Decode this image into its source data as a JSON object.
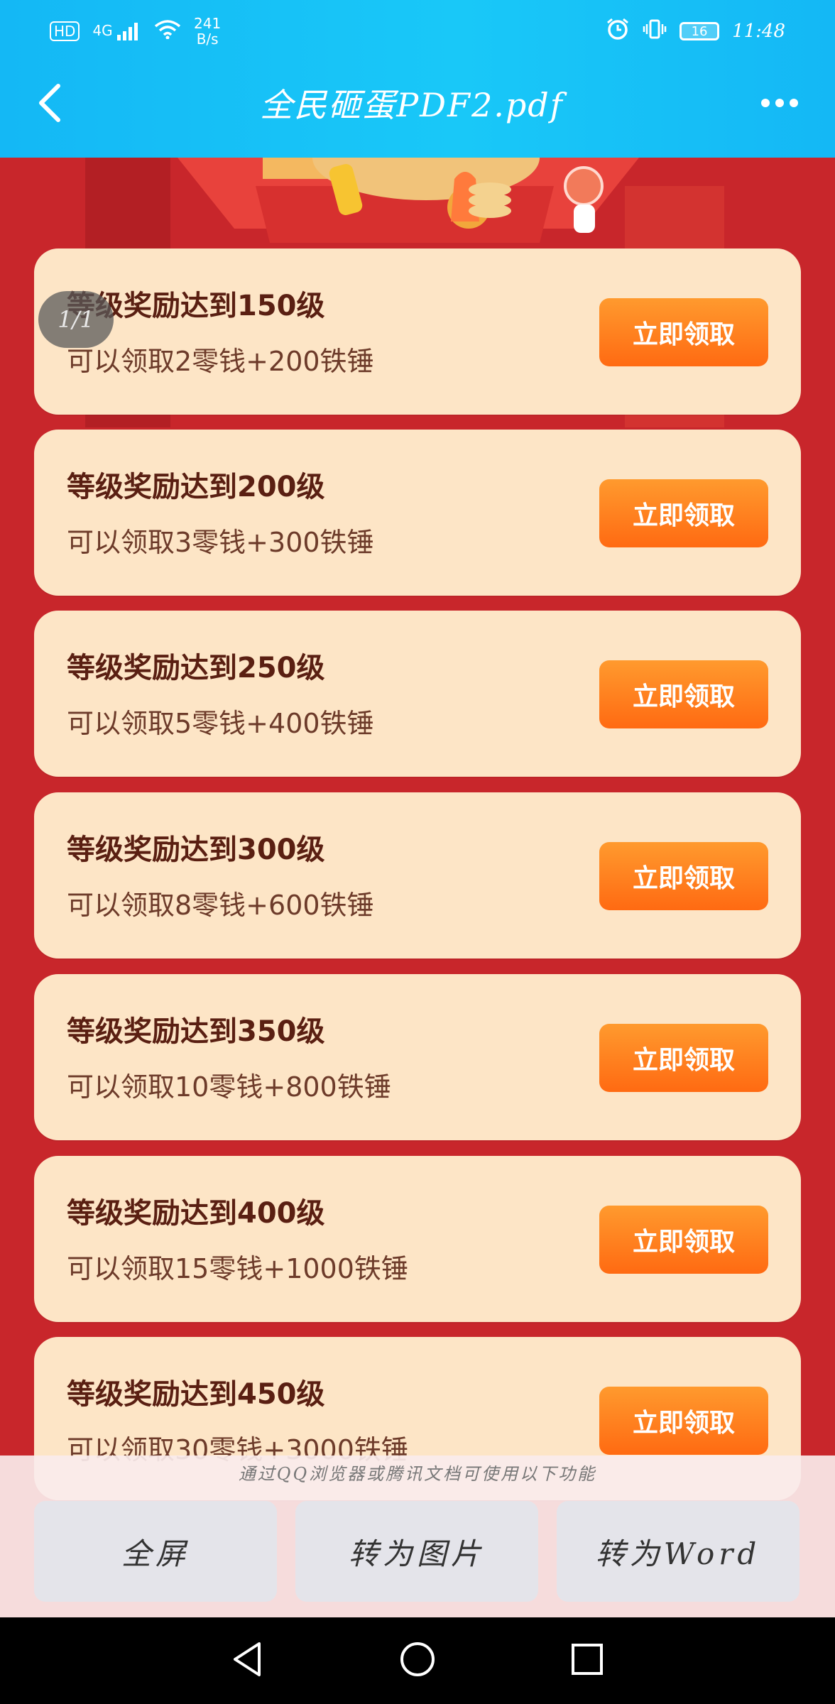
{
  "status_bar": {
    "network_speed_value": "241",
    "network_speed_unit": "B/s",
    "signal_label": "4G",
    "hd_label": "HD",
    "battery": "16",
    "time": "11:48"
  },
  "header": {
    "title": "全民砸蛋PDF2.pdf"
  },
  "page_indicator": "1/1",
  "cards": [
    {
      "title": "等级奖励达到150级",
      "subtitle": "可以领取2零钱+200铁锤",
      "button": "立即领取"
    },
    {
      "title": "等级奖励达到200级",
      "subtitle": "可以领取3零钱+300铁锤",
      "button": "立即领取"
    },
    {
      "title": "等级奖励达到250级",
      "subtitle": "可以领取5零钱+400铁锤",
      "button": "立即领取"
    },
    {
      "title": "等级奖励达到300级",
      "subtitle": "可以领取8零钱+600铁锤",
      "button": "立即领取"
    },
    {
      "title": "等级奖励达到350级",
      "subtitle": "可以领取10零钱+800铁锤",
      "button": "立即领取"
    },
    {
      "title": "等级奖励达到400级",
      "subtitle": "可以领取15零钱+1000铁锤",
      "button": "立即领取"
    },
    {
      "title": "等级奖励达到450级",
      "subtitle": "可以领取30零钱+3000铁锤",
      "button": "立即领取"
    }
  ],
  "bottom_panel": {
    "hint": "通过QQ浏览器或腾讯文档可使用以下功能",
    "actions": [
      "全屏",
      "转为图片",
      "转为Word"
    ]
  }
}
